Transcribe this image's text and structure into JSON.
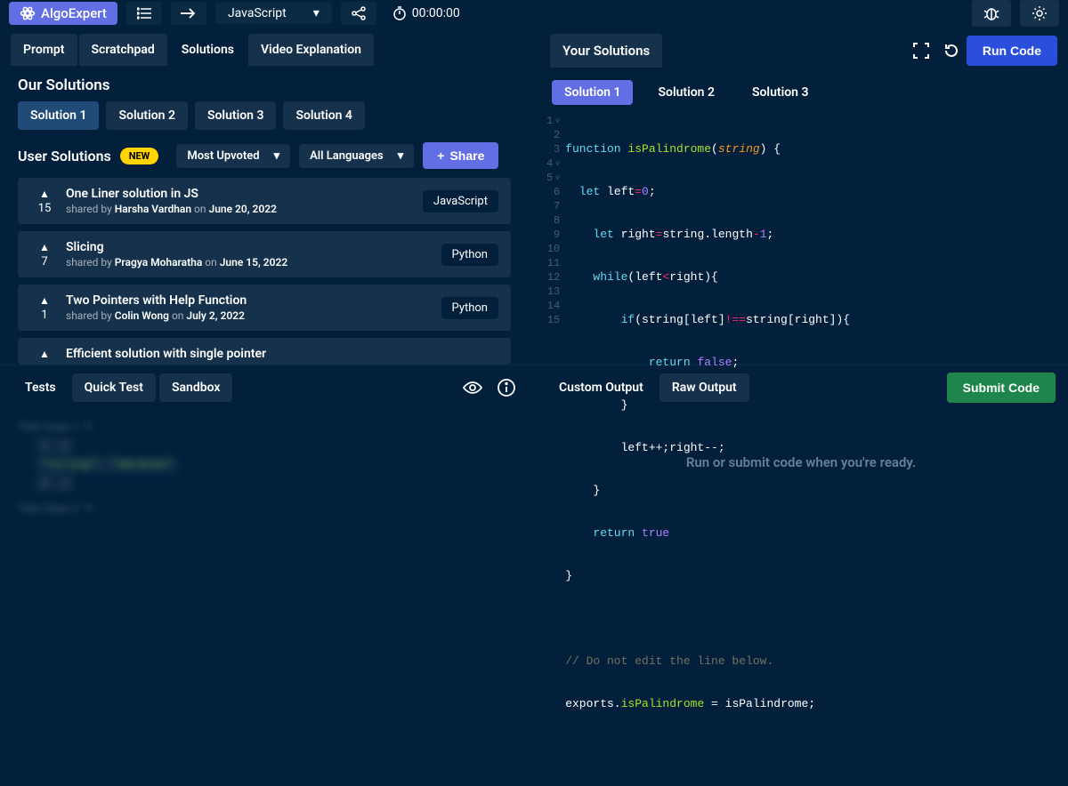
{
  "header": {
    "logo": "AlgoExpert",
    "language": "JavaScript",
    "timer": "00:00:00"
  },
  "leftTabs": [
    "Prompt",
    "Scratchpad",
    "Solutions",
    "Video Explanation"
  ],
  "leftActiveTab": 2,
  "ourSolutions": {
    "title": "Our Solutions",
    "tabs": [
      "Solution 1",
      "Solution 2",
      "Solution 3",
      "Solution 4"
    ],
    "active": 0
  },
  "userSolutions": {
    "title": "User Solutions",
    "newBadge": "NEW",
    "sort": "Most Upvoted",
    "langFilter": "All Languages",
    "shareLabel": "Share",
    "items": [
      {
        "votes": "15",
        "title": "One Liner solution in JS",
        "author": "Harsha Vardhan",
        "date": "June 20, 2022",
        "lang": "JavaScript"
      },
      {
        "votes": "7",
        "title": "Slicing",
        "author": "Pragya Moharatha",
        "date": "June 15, 2022",
        "lang": "Python"
      },
      {
        "votes": "1",
        "title": "Two Pointers with Help Function",
        "author": "Colin Wong",
        "date": "July 2, 2022",
        "lang": "Python"
      },
      {
        "votes": "",
        "title": "Efficient solution with single pointer",
        "author": "",
        "date": "",
        "lang": ""
      }
    ]
  },
  "yourSolutions": {
    "title": "Your Solutions",
    "runLabel": "Run Code",
    "tabs": [
      "Solution 1",
      "Solution 2",
      "Solution 3"
    ],
    "active": 0
  },
  "code": {
    "lines": 15,
    "l1": {
      "a": "function ",
      "b": "isPalindrome",
      "c": "(",
      "d": "string",
      "e": ") {"
    },
    "l2": {
      "a": "  let ",
      "b": "left",
      "c": "=",
      "d": "0",
      "e": ";"
    },
    "l3": {
      "a": "    let ",
      "b": "right",
      "c": "=",
      "d": "string.length",
      "e": "-",
      "f": "1",
      "g": ";"
    },
    "l4": {
      "a": "    while",
      "b": "(left",
      "c": "<",
      "d": "right){"
    },
    "l5": {
      "a": "        if",
      "b": "(string[left]",
      "c": "!==",
      "d": "string[right]){"
    },
    "l6": {
      "a": "            return ",
      "b": "false",
      "c": ";"
    },
    "l7": "        }",
    "l8": "        left++;right--;",
    "l9": "    }",
    "l10": {
      "a": "    return ",
      "b": "true"
    },
    "l11": "}",
    "l12": "",
    "l13": "// Do not edit the line below.",
    "l14": {
      "a": "exports.",
      "b": "isPalindrome",
      "c": " = isPalindrome;"
    }
  },
  "bottomLeft": {
    "tabs": [
      "Tests",
      "Quick Test",
      "Sandbox"
    ],
    "active": 0
  },
  "bottomRight": {
    "tabs": [
      "Custom Output",
      "Raw Output"
    ],
    "active": 0,
    "submitLabel": "Submit Code",
    "placeholder": "Run or submit code when you're ready."
  }
}
